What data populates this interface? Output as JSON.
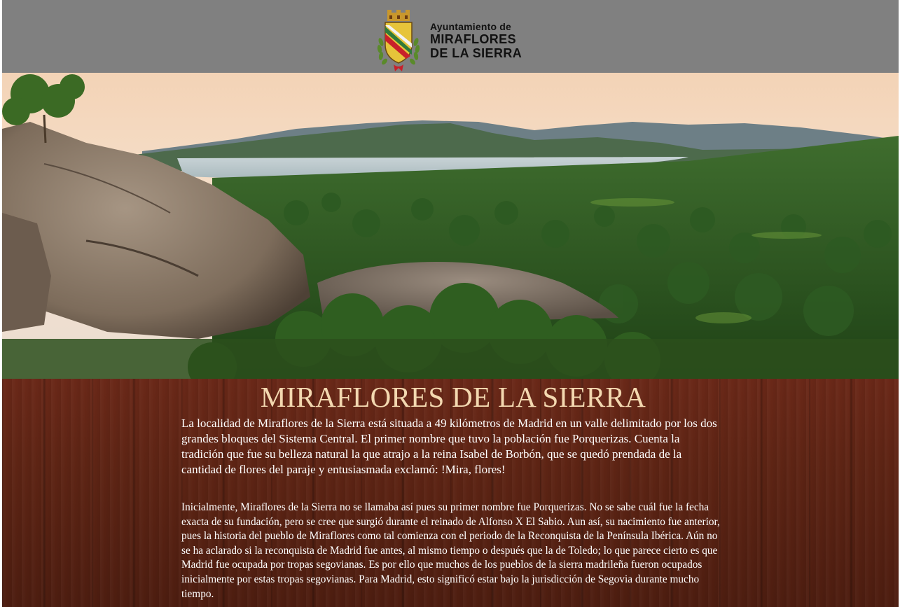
{
  "header": {
    "logo_line1": "Ayuntamiento de",
    "logo_line2": "MIRAFLORES",
    "logo_line3": "DE LA SIERRA"
  },
  "main": {
    "title": "MIRAFLORES DE LA SIERRA",
    "paragraph1": "La localidad de Miraflores de la Sierra está situada a 49 kilómetros de Madrid en un valle delimitado por los dos grandes bloques del Sistema Central. El primer nombre que tuvo la población fue Porquerizas. Cuenta la tradición que fue su belleza natural la que atrajo a la reina Isabel de Borbón, que se quedó prendada de la cantidad de flores del paraje y entusiasmada exclamó: !Mira, flores!",
    "paragraph2": "Inicialmente, Miraflores de la Sierra no se llamaba así pues su primer nombre fue Porquerizas. No se sabe cuál fue la fecha exacta de su fundación, pero se cree que surgió durante el reinado de Alfonso X El Sabio. Aun así, su nacimiento fue anterior, pues la historia del pueblo de Miraflores como tal comienza con el periodo de la Reconquista de la Península Ibérica. Aún no se ha aclarado si la reconquista de Madrid fue antes, al mismo tiempo o después que la de Toledo; lo que parece cierto es que Madrid fue ocupada por tropas segovianas. Es por ello que muchos de los pueblos de la sierra madrileña fueron ocupados inicialmente por estas tropas segovianas. Para Madrid, esto significó estar bajo la jurisdicción de Segovia durante mucho tiempo."
  },
  "colors": {
    "header_bg": "#808080",
    "title": "#f3d8b0",
    "wood": "#5d2414"
  },
  "icons": [
    "coat-of-arms-icon"
  ]
}
